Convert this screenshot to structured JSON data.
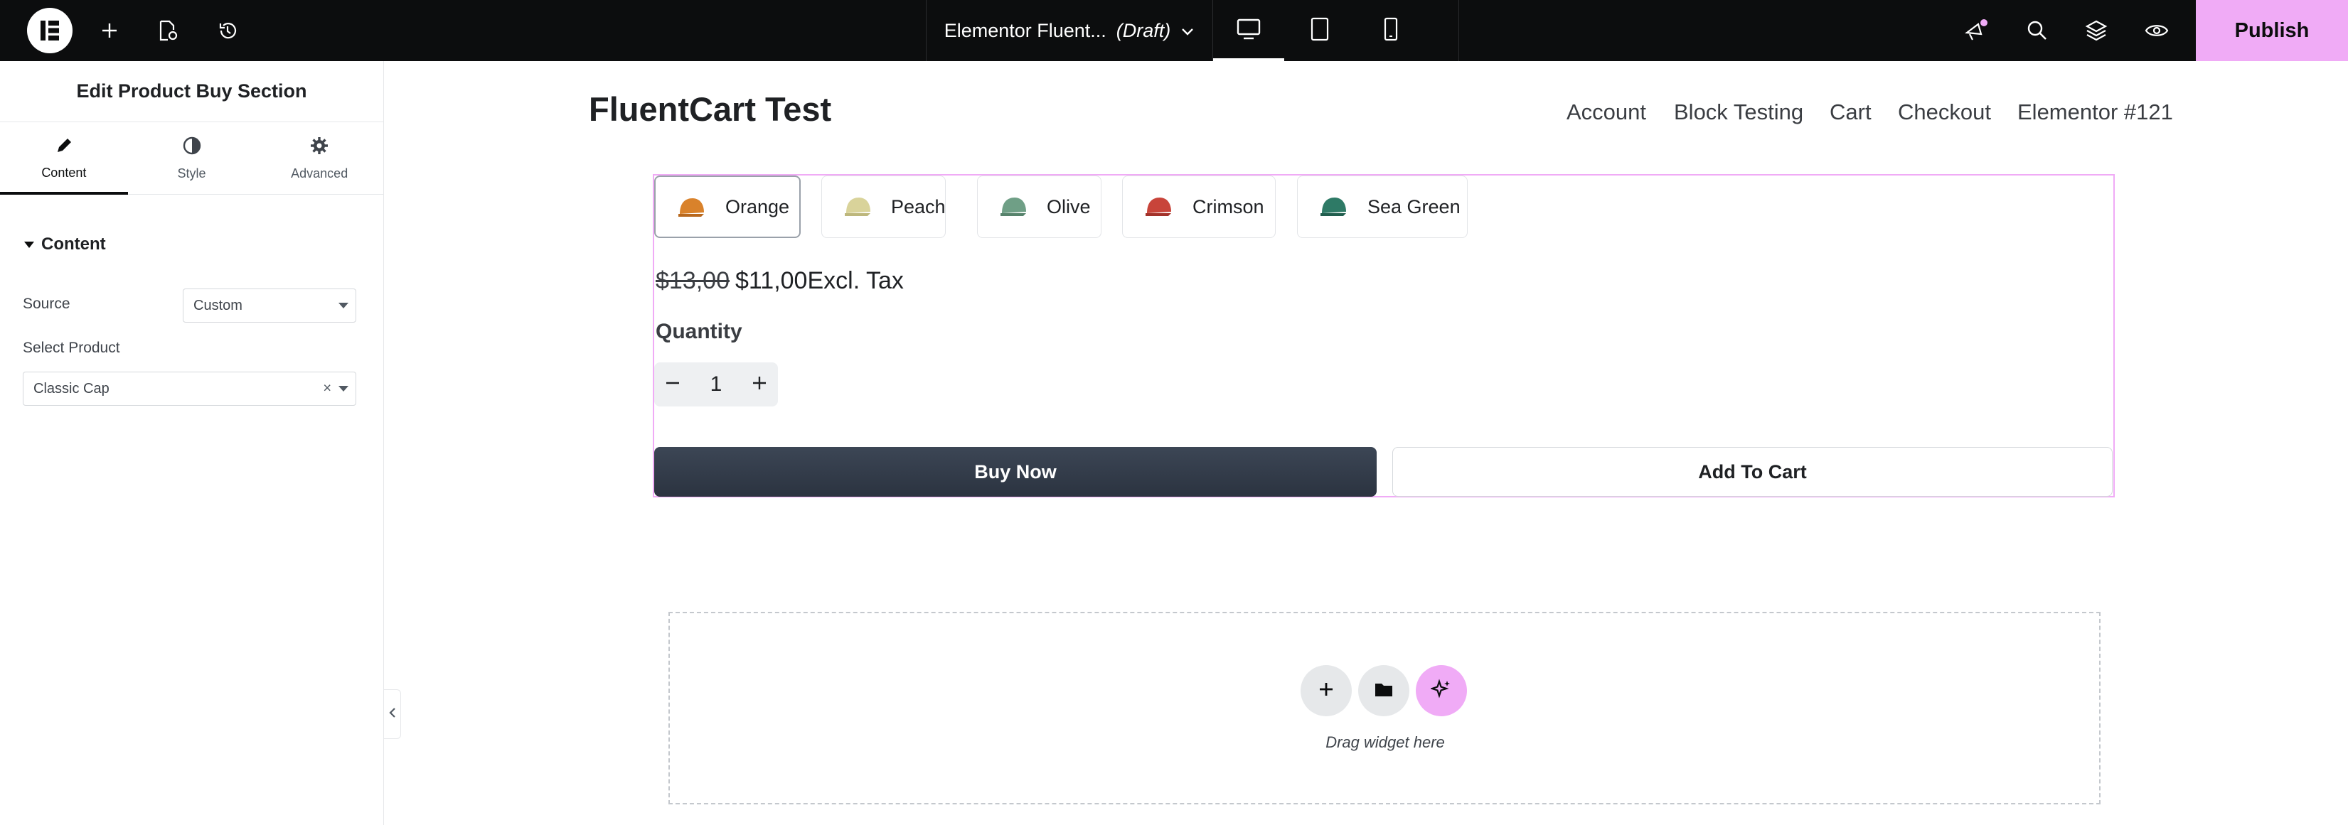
{
  "topbar": {
    "logo_icon": "elementor-logo-icon",
    "doc_title": "Elementor Fluent...",
    "doc_status": "(Draft)",
    "publish_label": "Publish",
    "accent_color": "#f0abf6"
  },
  "panel": {
    "title": "Edit Product Buy Section",
    "tabs": [
      {
        "label": "Content",
        "icon": "pencil-icon"
      },
      {
        "label": "Style",
        "icon": "half-circle-icon"
      },
      {
        "label": "Advanced",
        "icon": "gear-icon"
      }
    ],
    "section_title": "Content",
    "source_label": "Source",
    "source_value": "Custom",
    "product_label": "Select Product",
    "product_value": "Classic Cap",
    "clear_glyph": "×"
  },
  "site": {
    "title": "FluentCart Test",
    "nav": [
      "Account",
      "Block Testing",
      "Cart",
      "Checkout",
      "Elementor #121"
    ]
  },
  "product": {
    "variants": [
      {
        "label": "Orange",
        "color": "#d9822b"
      },
      {
        "label": "Peach",
        "color": "#d9d39a"
      },
      {
        "label": "Olive",
        "color": "#6f9f86"
      },
      {
        "label": "Crimson",
        "color": "#c8443a"
      },
      {
        "label": "Sea Green",
        "color": "#2e7a66"
      }
    ],
    "selected_variant": "Orange",
    "old_price": "$13,00",
    "price": "$11,00",
    "price_suffix": "Excl. Tax",
    "quantity_label": "Quantity",
    "quantity": "1",
    "buy_now_label": "Buy Now",
    "add_to_cart_label": "Add To Cart"
  },
  "dropzone": {
    "hint": "Drag widget here"
  }
}
